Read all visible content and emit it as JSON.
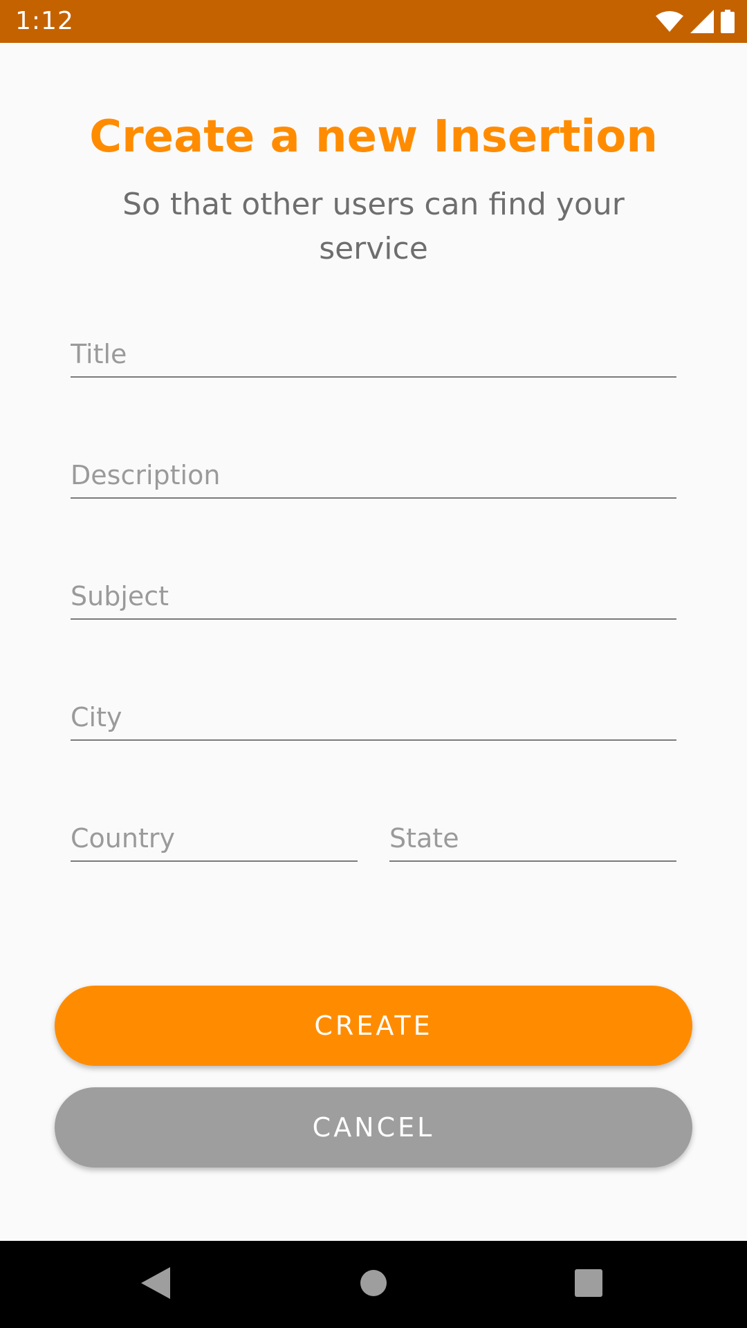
{
  "status_bar": {
    "time": "1:12",
    "icons": [
      "wifi-icon",
      "cellular-signal-icon",
      "battery-icon"
    ],
    "background": "#c56200"
  },
  "header": {
    "title": "Create a new Insertion",
    "subtitle": "So that other users can find your service"
  },
  "form": {
    "title_placeholder": "Title",
    "description_placeholder": "Description",
    "subject_placeholder": "Subject",
    "city_placeholder": "City",
    "country_placeholder": "Country",
    "state_placeholder": "State"
  },
  "actions": {
    "create_label": "CREATE",
    "cancel_label": "CANCEL"
  },
  "nav_bar": {
    "icons": [
      "back-icon",
      "home-icon",
      "recents-icon"
    ]
  },
  "colors": {
    "accent": "#ff8c00",
    "status_bar": "#c56200",
    "cancel": "#9e9e9e"
  }
}
